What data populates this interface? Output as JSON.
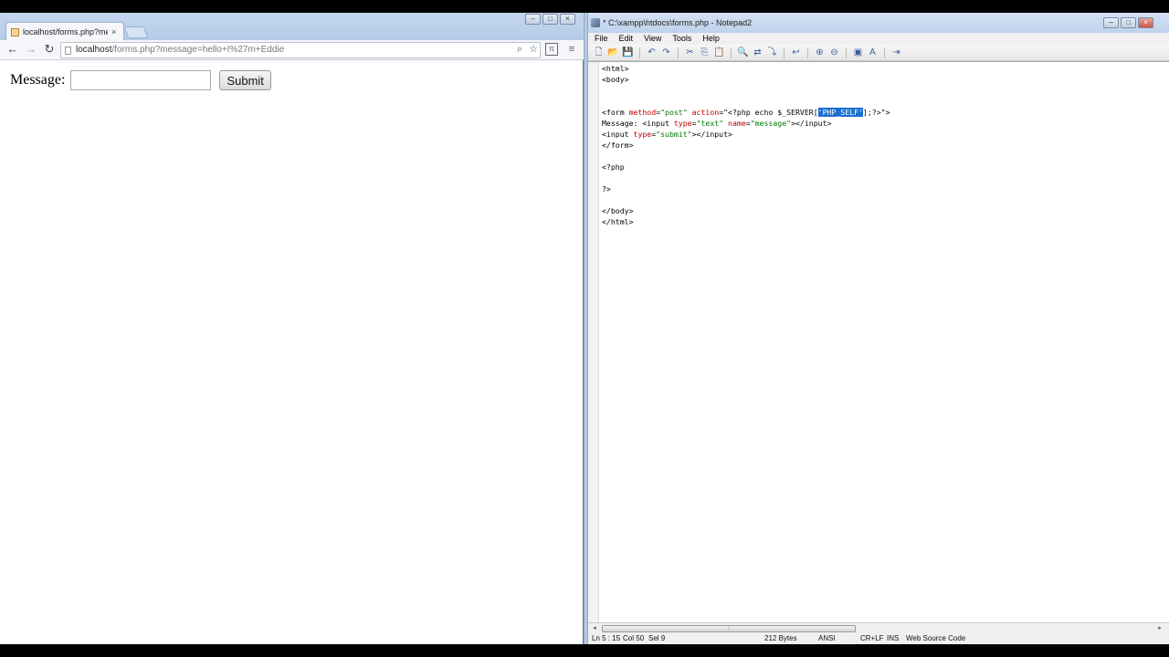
{
  "browser": {
    "tab_title": "localhost/forms.php?mes",
    "tab_close": "×",
    "url_host": "localhost",
    "url_path": "/forms.php?message=hello+I%27m+Eddie",
    "window_controls": [
      "–",
      "□",
      "×"
    ],
    "page": {
      "label": "Message:",
      "input_value": "",
      "submit_label": "Submit"
    }
  },
  "editor": {
    "title": "* C:\\xampp\\htdocs\\forms.php - Notepad2",
    "window_controls": [
      "–",
      "□",
      "×"
    ],
    "menu": [
      "File",
      "Edit",
      "View",
      "Tools",
      "Help"
    ],
    "code_lines": [
      "<html>",
      "<body>",
      "",
      "",
      "<form method=\"post\" action=\"<?php echo $_SERVER['PHP_SELF'];?>\">",
      "Message: <input type=\"text\" name=\"message\"></input>",
      "<input type=\"submit\"></input>",
      "</form>",
      "",
      "<?php",
      "",
      "?>",
      "",
      "</body>",
      "</html>"
    ],
    "selected_text": "'PHP_SELF'",
    "status": {
      "position": "Ln 5 : 15",
      "column": "Col 50",
      "selection": "Sel 9",
      "size": "212 Bytes",
      "encoding": "ANSI",
      "line_endings": "CR+LF",
      "mode": "INS",
      "scheme": "Web Source Code"
    }
  }
}
